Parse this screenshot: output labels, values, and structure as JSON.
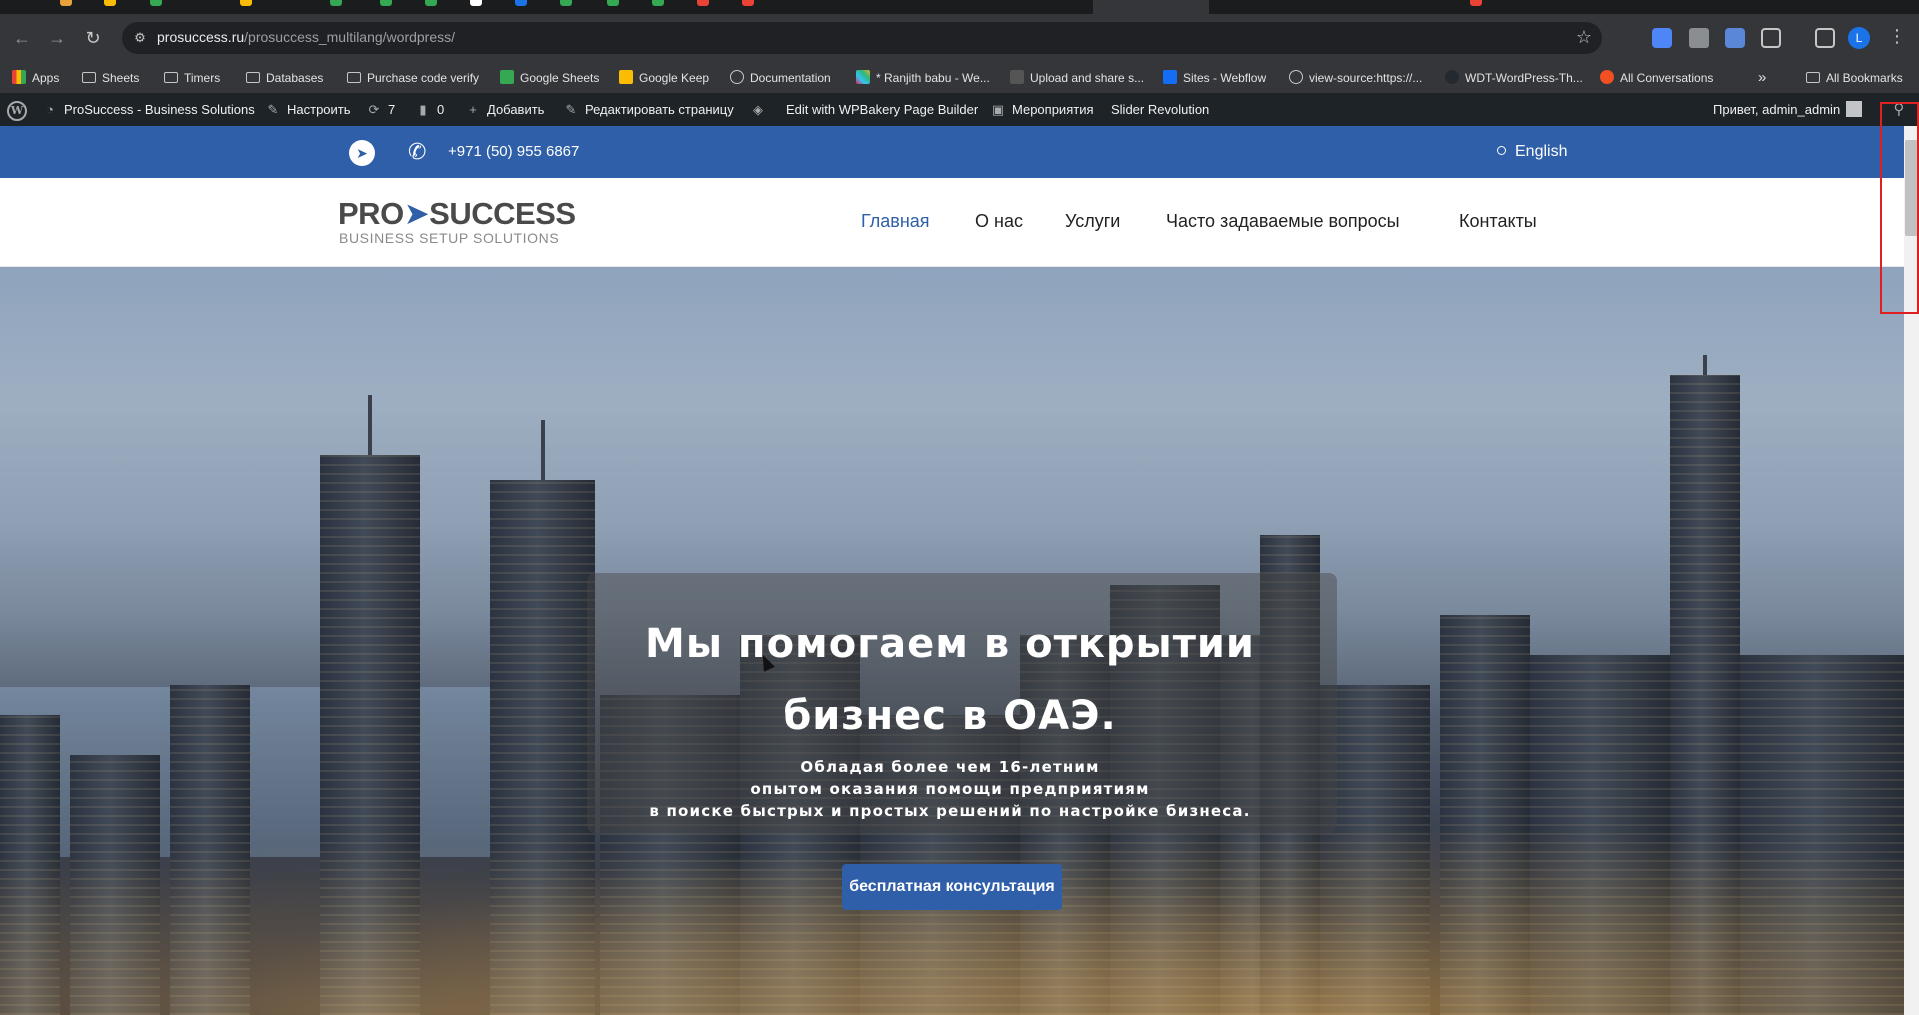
{
  "browser": {
    "url_host": "prosuccess.ru",
    "url_path": "/prosuccess_multilang/wordpress/",
    "profile_initial": "L",
    "bookmarks": [
      {
        "label": "Apps",
        "icon": "apps-icon"
      },
      {
        "label": "Sheets",
        "icon": "folder-icon"
      },
      {
        "label": "Timers",
        "icon": "folder-icon"
      },
      {
        "label": "Databases",
        "icon": "folder-icon"
      },
      {
        "label": "Purchase code verify",
        "icon": "folder-icon"
      },
      {
        "label": "Google Sheets",
        "icon": "google-sheets-icon"
      },
      {
        "label": "Google Keep",
        "icon": "google-keep-icon"
      },
      {
        "label": "Documentation",
        "icon": "globe-icon"
      },
      {
        "label": "* Ranjith babu - We...",
        "icon": "slack-icon"
      },
      {
        "label": "Upload and share s...",
        "icon": "sb-icon"
      },
      {
        "label": "Sites - Webflow",
        "icon": "webflow-icon"
      },
      {
        "label": "view-source:https://...",
        "icon": "globe-icon"
      },
      {
        "label": "WDT-WordPress-Th...",
        "icon": "github-icon"
      },
      {
        "label": "All Conversations",
        "icon": "chat-icon"
      }
    ],
    "more_bookmarks": "»",
    "all_bookmarks": "All Bookmarks"
  },
  "wpbar": {
    "site_name": "ProSuccess - Business Solutions",
    "customize": "Настроить",
    "updates_count": "7",
    "comments_count": "0",
    "add_new": "Добавить",
    "edit_page": "Редактировать страницу",
    "wpbakery": "Edit with WPBakery Page Builder",
    "events": "Мероприятия",
    "slider": "Slider Revolution",
    "greeting": "Привет, admin_admin"
  },
  "topbar": {
    "phone": "+971 (50) 955 6867",
    "language": "English"
  },
  "header": {
    "logo_main_left": "PRO",
    "logo_main_right": "SUCCESS",
    "logo_sub": "BUSINESS SETUP SOLUTIONS",
    "nav": [
      {
        "label": "Главная",
        "active": true
      },
      {
        "label": "О нас",
        "active": false
      },
      {
        "label": "Услуги",
        "active": false
      },
      {
        "label": "Часто задаваемые вопросы",
        "active": false
      },
      {
        "label": "Контакты",
        "active": false
      }
    ]
  },
  "hero": {
    "title_line1": "Мы помогаем в открытии",
    "title_line2": "бизнес в ОАЭ.",
    "subtitle_line1": "Обладая более чем 16-летним",
    "subtitle_line2": "опытом оказания помощи предприятиям",
    "subtitle_line3": "в поиске быстрых и простых решений по настройке бизнеса.",
    "cta_label": "бесплатная консультация"
  },
  "colors": {
    "brand_blue": "#2f5fa8",
    "wp_admin_bar": "#1d2327",
    "highlight_red": "#e02020"
  }
}
